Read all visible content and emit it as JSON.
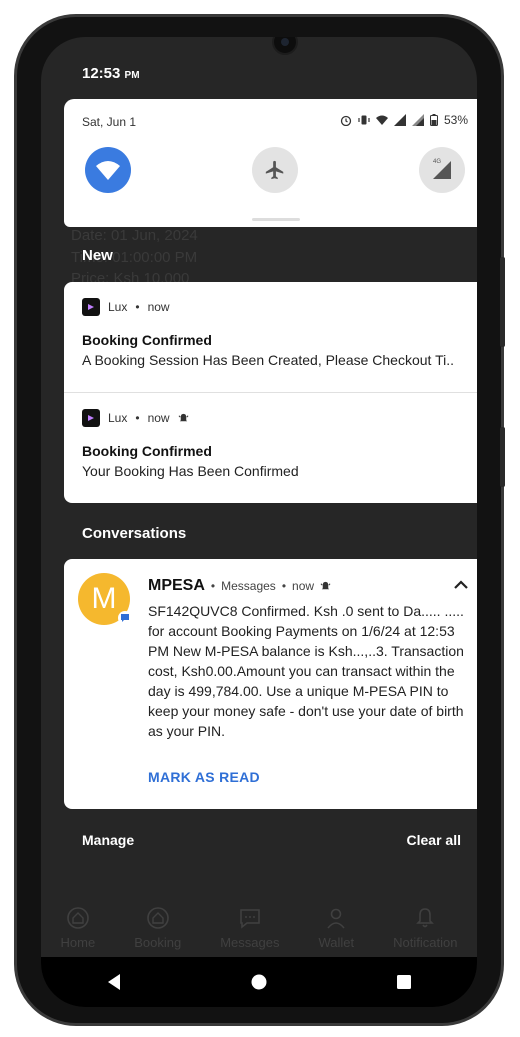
{
  "status_bar": {
    "time": "12:53",
    "ampm": "PM"
  },
  "quick_settings": {
    "date": "Sat, Jun 1",
    "battery": "53%",
    "network_label": "4G"
  },
  "background_order": {
    "date_line": "Date: 01 Jun, 2024",
    "time_line": "Time: 01:00:00 PM",
    "price_line": "Price: Ksh 10,000"
  },
  "sections": {
    "new": "New",
    "conversations": "Conversations"
  },
  "notifications": [
    {
      "app": "Lux",
      "time": "now",
      "title": "Booking Confirmed",
      "text": "A Booking Session Has Been Created, Please Checkout Ti..",
      "alert": false
    },
    {
      "app": "Lux",
      "time": "now",
      "title": "Booking Confirmed",
      "text": "Your Booking Has Been Confirmed",
      "alert": true
    }
  ],
  "conversation": {
    "avatar_letter": "M",
    "sender": "MPESA",
    "app": "Messages",
    "time": "now",
    "body": "SF142QUVC8 Confirmed. Ksh      .0 sent to Da.....  ..... for account Booking Payments on 1/6/24 at 12:53 PM New M-PESA balance is Ksh...,..3. Transaction cost, Ksh0.00.Amount you can transact within the day is 499,784.00. Use a unique M-PESA PIN to keep your money safe - don't use your date of birth as your PIN.",
    "action": "MARK AS READ"
  },
  "footer": {
    "manage": "Manage",
    "clear_all": "Clear all"
  },
  "bottom_nav": [
    {
      "label": "Home",
      "icon": "home-icon"
    },
    {
      "label": "Booking",
      "icon": "booking-icon"
    },
    {
      "label": "Messages",
      "icon": "messages-icon"
    },
    {
      "label": "Wallet",
      "icon": "wallet-icon"
    },
    {
      "label": "Notification",
      "icon": "bell-icon"
    }
  ],
  "colors": {
    "wifi_tile": "#3a7be0",
    "tile_off": "#e3e3e3",
    "avatar": "#f5b82e",
    "action": "#2f6fd6"
  }
}
